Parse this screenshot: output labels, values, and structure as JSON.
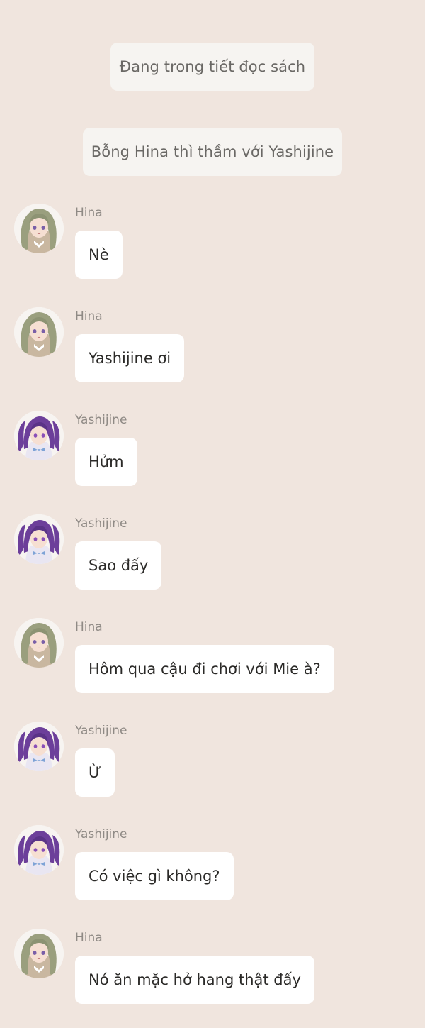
{
  "system_messages": [
    "Đang trong tiết đọc sách",
    "Bỗng Hina thì thầm với Yashijine"
  ],
  "messages": [
    {
      "speaker": "Hina",
      "text": "Nè"
    },
    {
      "speaker": "Hina",
      "text": "Yashijine ơi"
    },
    {
      "speaker": "Yashijine",
      "text": "Hửm"
    },
    {
      "speaker": "Yashijine",
      "text": "Sao đấy"
    },
    {
      "speaker": "Hina",
      "text": "Hôm qua cậu đi chơi với Mie à?"
    },
    {
      "speaker": "Yashijine",
      "text": "Ừ"
    },
    {
      "speaker": "Yashijine",
      "text": "Có việc gì không?"
    },
    {
      "speaker": "Hina",
      "text": "Nó ăn mặc hở hang thật đấy"
    }
  ],
  "colors": {
    "background": "#f0e5de",
    "system_bubble": "#f6f4f1",
    "message_bubble": "#ffffff",
    "hina_hair": "#9a9f7e",
    "yashijine_hair": "#6c3f9a"
  }
}
